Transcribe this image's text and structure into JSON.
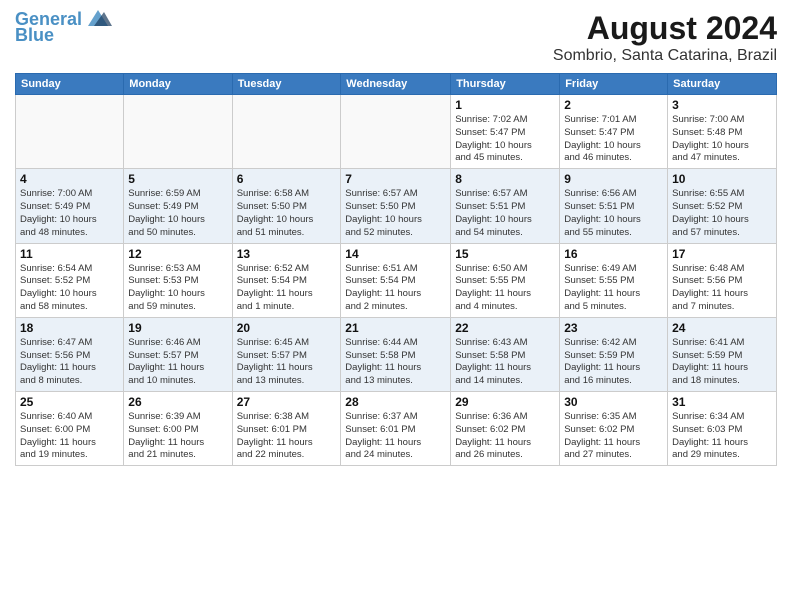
{
  "logo": {
    "line1": "General",
    "line2": "Blue"
  },
  "title": "August 2024",
  "subtitle": "Sombrio, Santa Catarina, Brazil",
  "days_header": [
    "Sunday",
    "Monday",
    "Tuesday",
    "Wednesday",
    "Thursday",
    "Friday",
    "Saturday"
  ],
  "weeks": [
    [
      {
        "day": "",
        "info": ""
      },
      {
        "day": "",
        "info": ""
      },
      {
        "day": "",
        "info": ""
      },
      {
        "day": "",
        "info": ""
      },
      {
        "day": "1",
        "info": "Sunrise: 7:02 AM\nSunset: 5:47 PM\nDaylight: 10 hours\nand 45 minutes."
      },
      {
        "day": "2",
        "info": "Sunrise: 7:01 AM\nSunset: 5:47 PM\nDaylight: 10 hours\nand 46 minutes."
      },
      {
        "day": "3",
        "info": "Sunrise: 7:00 AM\nSunset: 5:48 PM\nDaylight: 10 hours\nand 47 minutes."
      }
    ],
    [
      {
        "day": "4",
        "info": "Sunrise: 7:00 AM\nSunset: 5:49 PM\nDaylight: 10 hours\nand 48 minutes."
      },
      {
        "day": "5",
        "info": "Sunrise: 6:59 AM\nSunset: 5:49 PM\nDaylight: 10 hours\nand 50 minutes."
      },
      {
        "day": "6",
        "info": "Sunrise: 6:58 AM\nSunset: 5:50 PM\nDaylight: 10 hours\nand 51 minutes."
      },
      {
        "day": "7",
        "info": "Sunrise: 6:57 AM\nSunset: 5:50 PM\nDaylight: 10 hours\nand 52 minutes."
      },
      {
        "day": "8",
        "info": "Sunrise: 6:57 AM\nSunset: 5:51 PM\nDaylight: 10 hours\nand 54 minutes."
      },
      {
        "day": "9",
        "info": "Sunrise: 6:56 AM\nSunset: 5:51 PM\nDaylight: 10 hours\nand 55 minutes."
      },
      {
        "day": "10",
        "info": "Sunrise: 6:55 AM\nSunset: 5:52 PM\nDaylight: 10 hours\nand 57 minutes."
      }
    ],
    [
      {
        "day": "11",
        "info": "Sunrise: 6:54 AM\nSunset: 5:52 PM\nDaylight: 10 hours\nand 58 minutes."
      },
      {
        "day": "12",
        "info": "Sunrise: 6:53 AM\nSunset: 5:53 PM\nDaylight: 10 hours\nand 59 minutes."
      },
      {
        "day": "13",
        "info": "Sunrise: 6:52 AM\nSunset: 5:54 PM\nDaylight: 11 hours\nand 1 minute."
      },
      {
        "day": "14",
        "info": "Sunrise: 6:51 AM\nSunset: 5:54 PM\nDaylight: 11 hours\nand 2 minutes."
      },
      {
        "day": "15",
        "info": "Sunrise: 6:50 AM\nSunset: 5:55 PM\nDaylight: 11 hours\nand 4 minutes."
      },
      {
        "day": "16",
        "info": "Sunrise: 6:49 AM\nSunset: 5:55 PM\nDaylight: 11 hours\nand 5 minutes."
      },
      {
        "day": "17",
        "info": "Sunrise: 6:48 AM\nSunset: 5:56 PM\nDaylight: 11 hours\nand 7 minutes."
      }
    ],
    [
      {
        "day": "18",
        "info": "Sunrise: 6:47 AM\nSunset: 5:56 PM\nDaylight: 11 hours\nand 8 minutes."
      },
      {
        "day": "19",
        "info": "Sunrise: 6:46 AM\nSunset: 5:57 PM\nDaylight: 11 hours\nand 10 minutes."
      },
      {
        "day": "20",
        "info": "Sunrise: 6:45 AM\nSunset: 5:57 PM\nDaylight: 11 hours\nand 13 minutes."
      },
      {
        "day": "21",
        "info": "Sunrise: 6:44 AM\nSunset: 5:58 PM\nDaylight: 11 hours\nand 13 minutes."
      },
      {
        "day": "22",
        "info": "Sunrise: 6:43 AM\nSunset: 5:58 PM\nDaylight: 11 hours\nand 14 minutes."
      },
      {
        "day": "23",
        "info": "Sunrise: 6:42 AM\nSunset: 5:59 PM\nDaylight: 11 hours\nand 16 minutes."
      },
      {
        "day": "24",
        "info": "Sunrise: 6:41 AM\nSunset: 5:59 PM\nDaylight: 11 hours\nand 18 minutes."
      }
    ],
    [
      {
        "day": "25",
        "info": "Sunrise: 6:40 AM\nSunset: 6:00 PM\nDaylight: 11 hours\nand 19 minutes."
      },
      {
        "day": "26",
        "info": "Sunrise: 6:39 AM\nSunset: 6:00 PM\nDaylight: 11 hours\nand 21 minutes."
      },
      {
        "day": "27",
        "info": "Sunrise: 6:38 AM\nSunset: 6:01 PM\nDaylight: 11 hours\nand 22 minutes."
      },
      {
        "day": "28",
        "info": "Sunrise: 6:37 AM\nSunset: 6:01 PM\nDaylight: 11 hours\nand 24 minutes."
      },
      {
        "day": "29",
        "info": "Sunrise: 6:36 AM\nSunset: 6:02 PM\nDaylight: 11 hours\nand 26 minutes."
      },
      {
        "day": "30",
        "info": "Sunrise: 6:35 AM\nSunset: 6:02 PM\nDaylight: 11 hours\nand 27 minutes."
      },
      {
        "day": "31",
        "info": "Sunrise: 6:34 AM\nSunset: 6:03 PM\nDaylight: 11 hours\nand 29 minutes."
      }
    ]
  ]
}
